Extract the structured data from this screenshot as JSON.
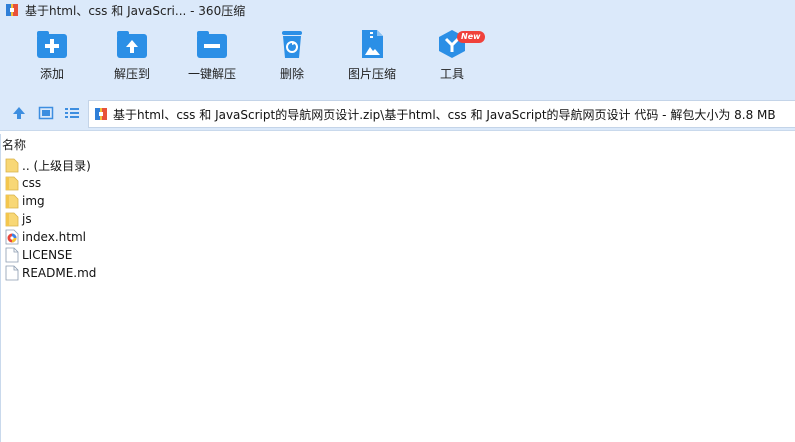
{
  "window": {
    "title": "基于html、css 和 JavaScri... - 360压缩"
  },
  "toolbar": {
    "items": [
      {
        "label": "添加",
        "icon": "add-icon"
      },
      {
        "label": "解压到",
        "icon": "extract-to-icon"
      },
      {
        "label": "一键解压",
        "icon": "one-click-extract-icon"
      },
      {
        "label": "删除",
        "icon": "delete-icon"
      },
      {
        "label": "图片压缩",
        "icon": "image-compress-icon"
      },
      {
        "label": "工具",
        "icon": "tools-icon",
        "badge": "New"
      }
    ]
  },
  "addressbar": {
    "path": "基于html、css 和 JavaScript的导航网页设计.zip\\基于html、css 和 JavaScript的导航网页设计 代码 - 解包大小为 8.8 MB"
  },
  "filelist": {
    "column_name": "名称",
    "items": [
      {
        "name": ".. (上级目录)",
        "type": "folder"
      },
      {
        "name": "css",
        "type": "folder"
      },
      {
        "name": "img",
        "type": "folder"
      },
      {
        "name": "js",
        "type": "folder"
      },
      {
        "name": "index.html",
        "type": "html"
      },
      {
        "name": "LICENSE",
        "type": "file"
      },
      {
        "name": "README.md",
        "type": "file"
      }
    ]
  },
  "colors": {
    "toolbar_bg": "#dbe9fa",
    "icon_blue": "#2b8fe6",
    "badge_red": "#f0413b",
    "folder_yellow": "#f8d775"
  }
}
